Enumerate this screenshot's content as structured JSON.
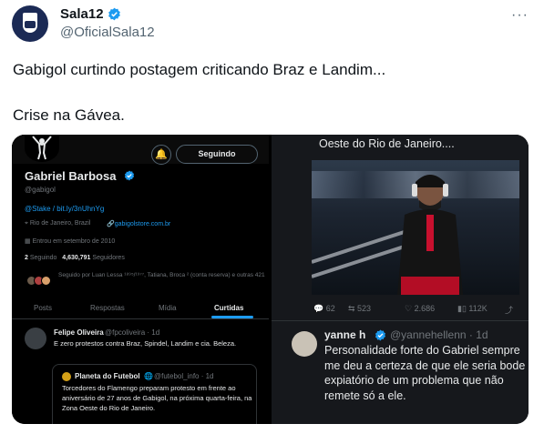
{
  "tweet": {
    "author_name": "Sala12",
    "author_handle": "@OficialSala12",
    "more_icon": "···",
    "text_line1": "Gabigol curtindo postagem criticando Braz e Landim...",
    "text_line2": "Crise na Gávea."
  },
  "profile": {
    "name": "Gabriel Barbosa",
    "handle": "@gabigol",
    "follow_button": "Seguindo",
    "bio": "@Stake / bit.ly/3nUhnYg",
    "location": "Rio de Janeiro, Brazil",
    "website": "gabigolstore.com.br",
    "joined": "Entrou em setembro de 2010",
    "following_count": "2",
    "following_label": "Seguindo",
    "followers_count": "4,630,791",
    "followers_label": "Seguidores",
    "followed_by": "Seguido por Luan Lessa ¹⁸⁹⁵/¹⁹⁷⁷, Tatiana, Broca ² (conta reserva) e outras 421",
    "tabs": [
      "Posts",
      "Respostas",
      "Mídia",
      "Curtidas"
    ],
    "active_tab": "Curtidas"
  },
  "liked_post": {
    "name": "Felipe Oliveira",
    "handle": "@fpcoliveira · 1d",
    "text": "E zero protestos contra Braz, Spindel, Landim e cia. Beleza.",
    "quote_name": "Planeta do Futebol",
    "quote_handle": "@futebol_info · 1d",
    "quote_text": "Torcedores do Flamengo preparam protesto em frente ao aniversário de 27 anos de Gabigol, na próxima quarta-feira, na Zona Oeste do Rio de Janeiro."
  },
  "right_panel": {
    "caption": "Oeste do Rio de Janeiro....",
    "replies": "62",
    "retweets": "523",
    "likes": "2.686",
    "views": "112K",
    "reply_name": "yanne h",
    "reply_handle": "@yannehellenn · 1d",
    "reply_text": "Personalidade forte do Gabriel sempre me deu a certeza de que ele seria bode expiatório de um problema que não remete só a ele."
  },
  "colors": {
    "accent": "#1d9bf0",
    "text": "#0f1419",
    "muted": "#536471",
    "dark_bg": "#000000"
  }
}
